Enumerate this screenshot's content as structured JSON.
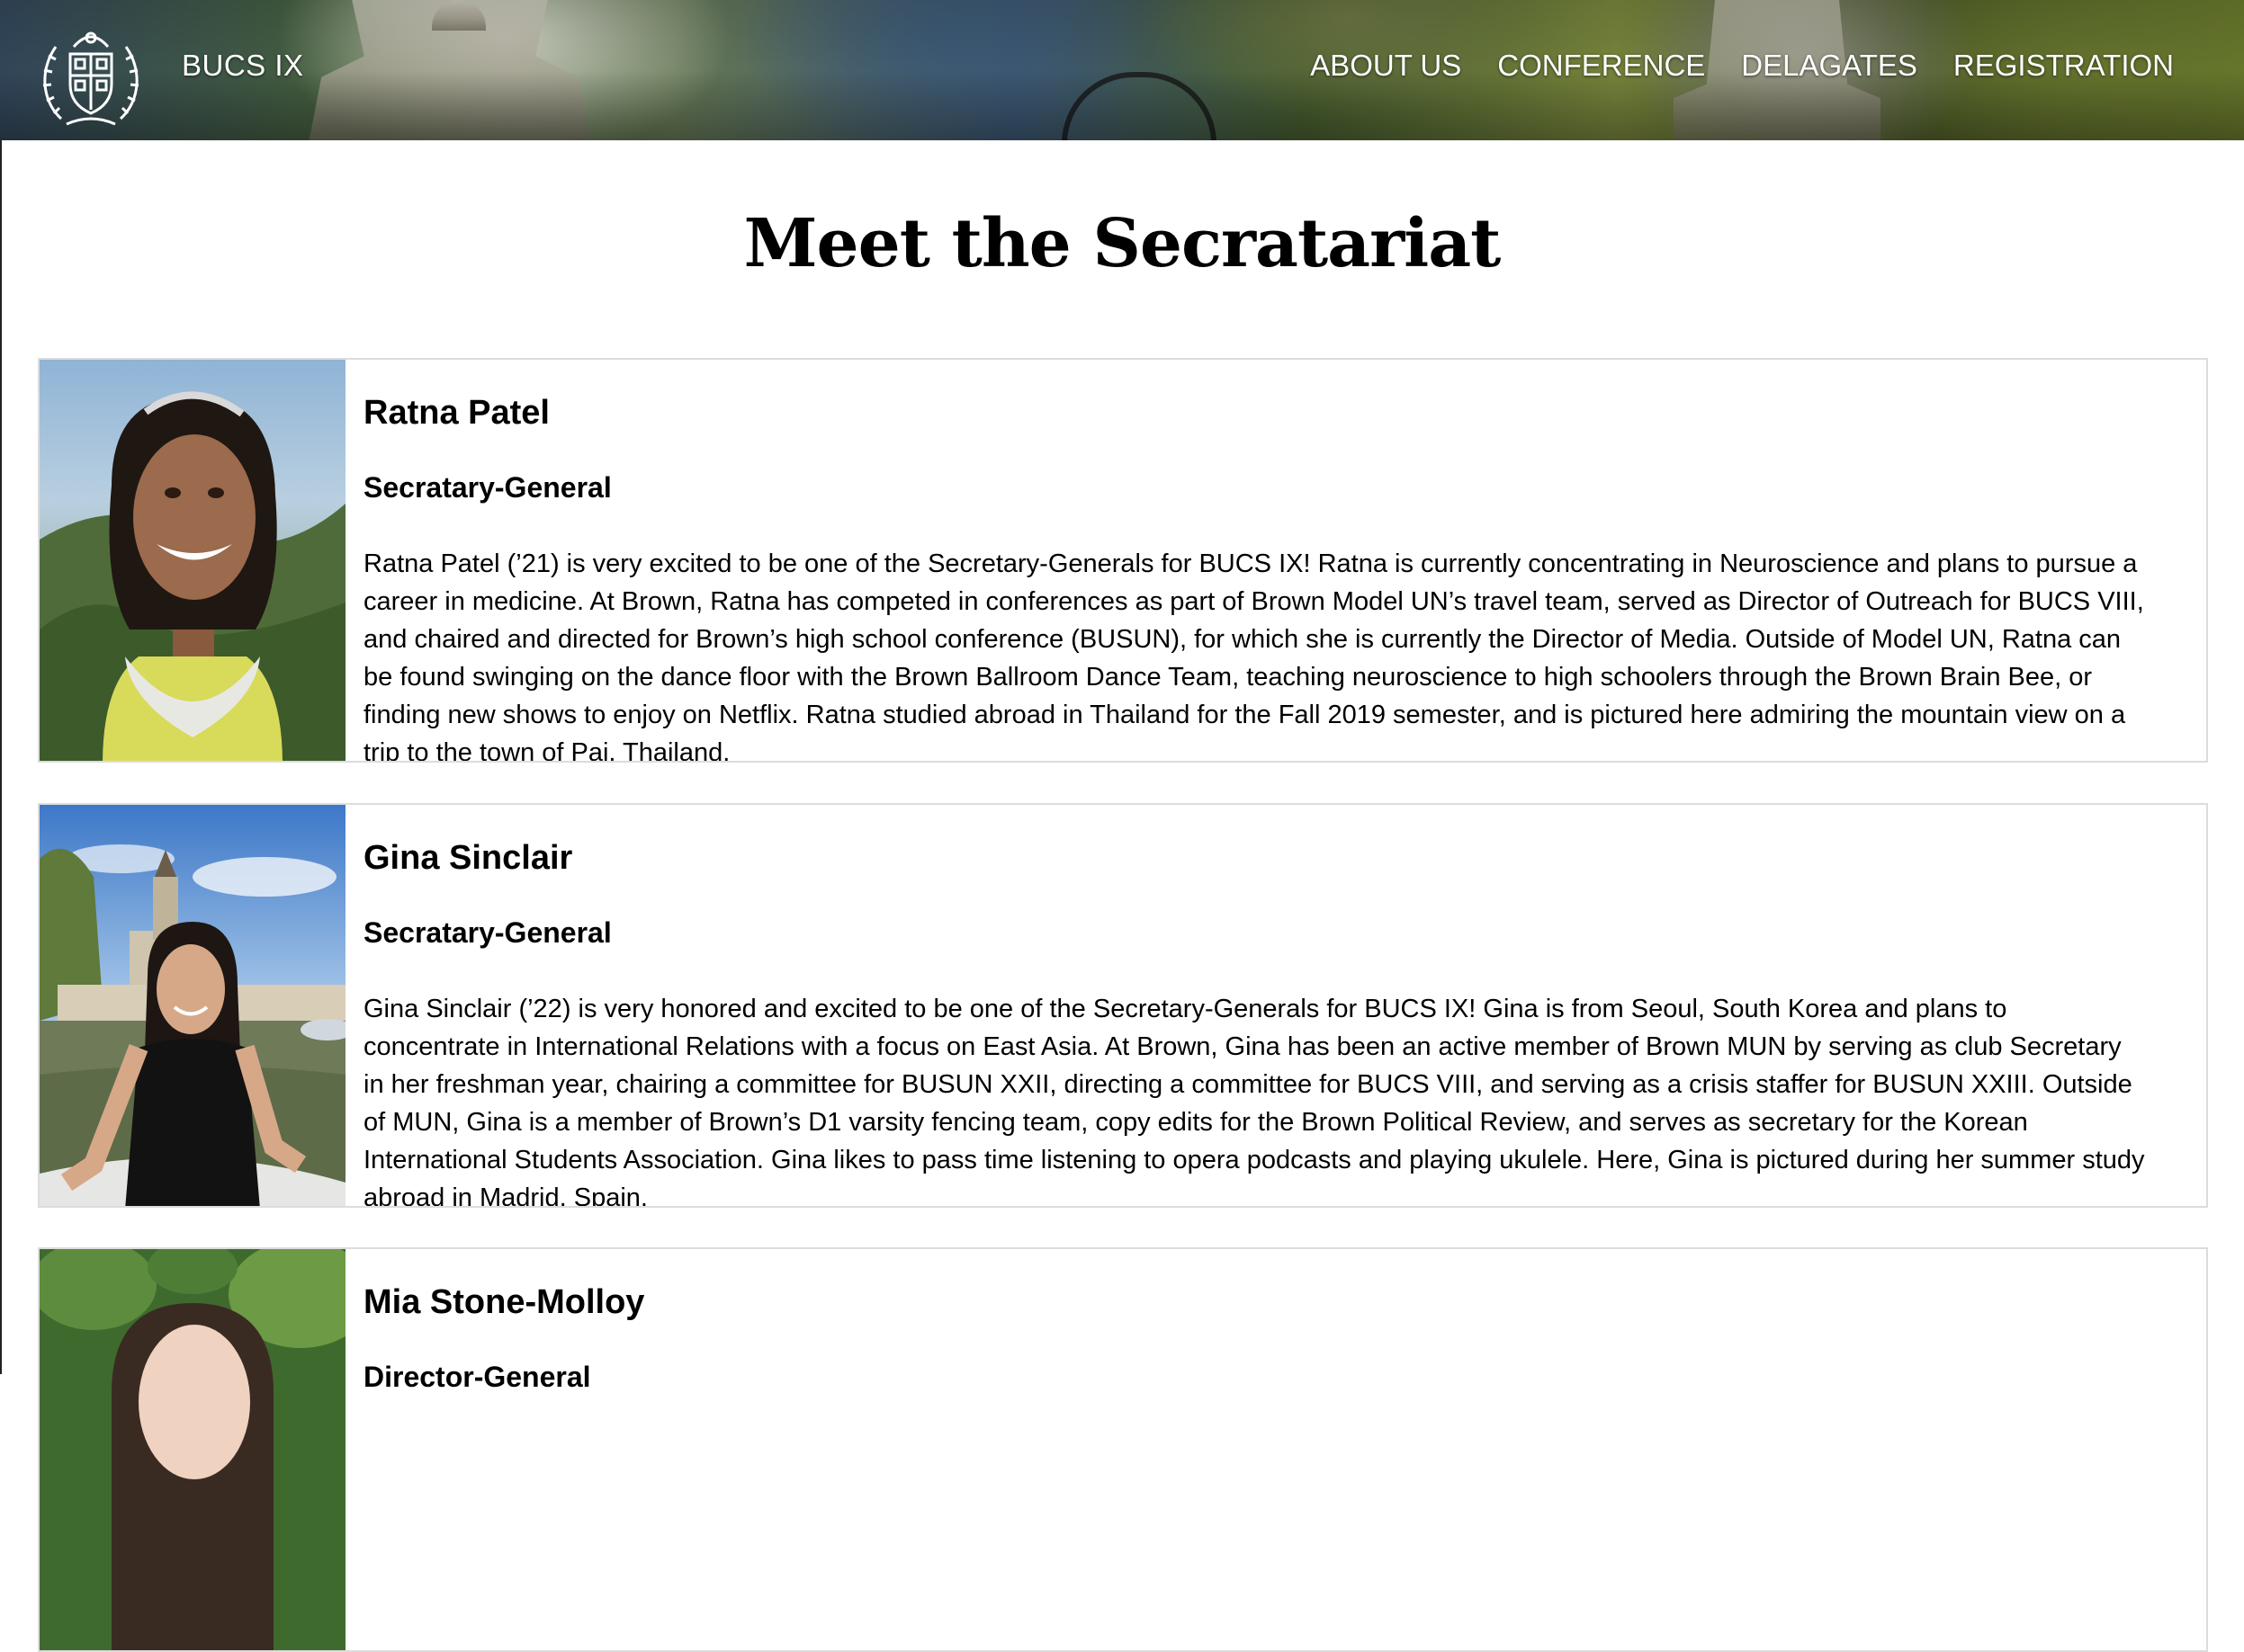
{
  "header": {
    "site_title": "BUCS IX",
    "nav": [
      {
        "label": "ABOUT US"
      },
      {
        "label": "CONFERENCE"
      },
      {
        "label": "DELAGATES"
      },
      {
        "label": "REGISTRATION"
      }
    ]
  },
  "main": {
    "page_title": "Meet the Secratariat",
    "members": [
      {
        "name": "Ratna Patel",
        "role": "Secratary-General",
        "bio": "Ratna Patel (’21) is very excited to be one of the Secretary-Generals for BUCS IX! Ratna is currently concentrating in Neuroscience and plans to pursue a career in medicine. At Brown, Ratna has competed in conferences as part of Brown Model UN’s travel team, served as Director of Outreach for BUCS VIII, and chaired and directed for Brown’s high school conference (BUSUN), for which she is currently the Director of Media. Outside of Model UN, Ratna can be found swinging on the dance floor with the Brown Ballroom Dance Team, teaching neuroscience to high schoolers through the Brown Brain Bee, or finding new shows to enjoy on Netflix. Ratna studied abroad in Thailand for the Fall 2019 semester, and is pictured here admiring the mountain view on a trip to the town of Pai, Thailand."
      },
      {
        "name": "Gina Sinclair",
        "role": "Secratary-General",
        "bio": "Gina Sinclair (’22) is very honored and excited to be one of the Secretary-Generals for BUCS IX! Gina is from Seoul, South Korea and plans to concentrate in International Relations with a focus on East Asia. At Brown, Gina has been an active member of Brown MUN by serving as club Secretary in her freshman year, chairing a committee for BUSUN XXII, directing a committee for BUCS VIII, and serving as a crisis staffer for BUSUN XXIII. Outside of MUN, Gina is a member of Brown’s D1 varsity fencing team, copy edits for the Brown Political Review, and serves as secretary for the Korean International Students Association. Gina likes to pass time listening to opera podcasts and playing ukulele. Here, Gina is pictured during her summer study abroad in Madrid, Spain."
      },
      {
        "name": "Mia Stone-Molloy",
        "role": "Director-General",
        "bio": ""
      }
    ]
  }
}
